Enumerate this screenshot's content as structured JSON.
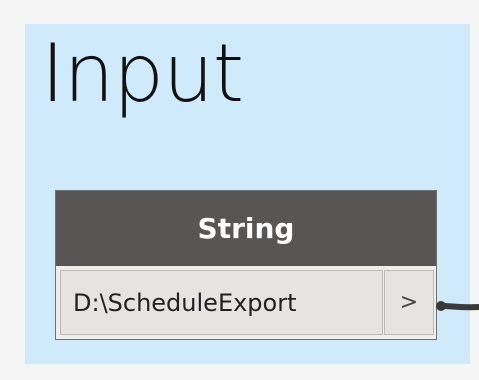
{
  "group": {
    "title": "Input"
  },
  "node": {
    "header_label": "String",
    "input_value": "D:\\ScheduleExport",
    "output_port_label": ">"
  },
  "colors": {
    "group_background": "#cfeafb",
    "node_header": "#575655",
    "node_body": "#efeeeb",
    "wire": "#3a3a3a"
  }
}
